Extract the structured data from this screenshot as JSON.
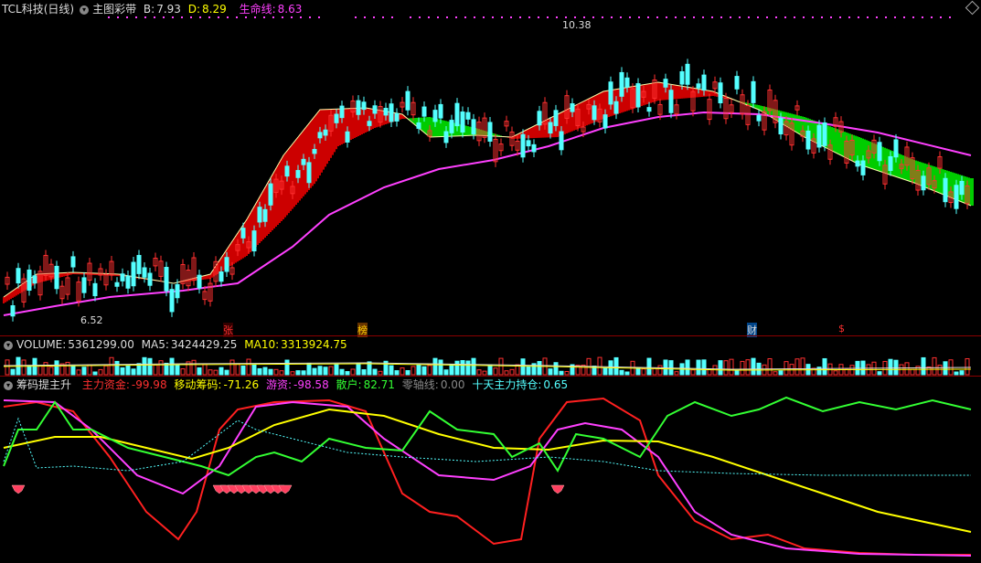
{
  "main": {
    "title": "TCL科技(日线)",
    "indicator": "主图彩带",
    "b_label": "B:",
    "b_value": "7.93",
    "d_label": "D:",
    "d_value": "8.29",
    "life_label": "生命线:",
    "life_value": "8.63",
    "high_mark": "10.38",
    "low_mark": "6.52",
    "event_1": "张",
    "event_2": "榜",
    "event_3": "财",
    "event_4": "$"
  },
  "volume": {
    "label": "VOLUME:",
    "value": "5361299.00",
    "ma5_label": "MA5:",
    "ma5_value": "3424429.25",
    "ma10_label": "MA10:",
    "ma10_value": "3313924.75"
  },
  "chips": {
    "title": "筹码提主升",
    "main_fund_label": "主力资金:",
    "main_fund_value": "-99.98",
    "moving_label": "移动筹码:",
    "moving_value": "-71.26",
    "hot_label": "游资:",
    "hot_value": "-98.58",
    "retail_label": "散户:",
    "retail_value": "82.71",
    "zero_label": "零轴线:",
    "zero_value": "0.00",
    "ten_day_label": "十天主力持仓:",
    "ten_day_value": "0.65"
  },
  "colors": {
    "up": "#ff3030",
    "down": "#54ffff",
    "band_up": "#cc0000",
    "band_down": "#00cc00",
    "life_line": "#ff40ff",
    "yellow": "#ffff00",
    "green": "#33ff33"
  },
  "icons": [
    "collapse-circle-icon",
    "diamond-icon",
    "gem-signal-icon"
  ]
}
